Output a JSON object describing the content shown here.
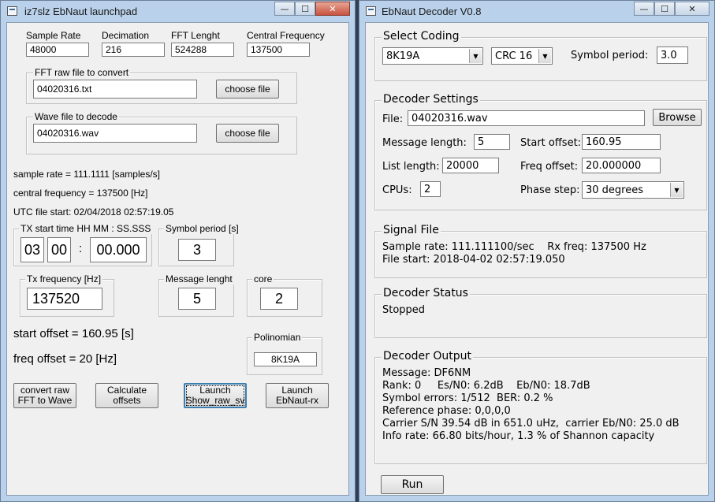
{
  "launchpad": {
    "title": "iz7slz EbNaut launchpad",
    "fields": {
      "sample_rate": {
        "label": "Sample Rate",
        "value": "48000"
      },
      "decimation": {
        "label": "Decimation",
        "value": "216"
      },
      "fft_length": {
        "label": "FFT Lenght",
        "value": "524288"
      },
      "central_freq": {
        "label": "Central Frequency",
        "value": "137500"
      }
    },
    "fft_group": {
      "legend": "FFT raw file to convert",
      "value": "04020316.txt",
      "button": "choose file"
    },
    "wave_group": {
      "legend": "Wave file to decode",
      "value": "04020316.wav",
      "button": "choose file"
    },
    "info": {
      "sample_rate": "sample rate = 111.1111 [samples/s]",
      "central_frequency": "central frequency = 137500 [Hz]",
      "utc_start": "UTC file start: 02/04/2018 02:57:19.05"
    },
    "tx_start": {
      "legend": "TX start time  HH MM : SS.SSS",
      "hh": "03",
      "mm": "00",
      "colon": ":",
      "ss": "00.000"
    },
    "symbol_period": {
      "legend": "Symbol period [s]",
      "value": "3"
    },
    "tx_freq": {
      "legend": "Tx frequency [Hz]",
      "value": "137520"
    },
    "message_length": {
      "legend": "Message lenght",
      "value": "5"
    },
    "core": {
      "legend": "core",
      "value": "2"
    },
    "start_offset": "start offset =  160.95 [s]",
    "freq_offset": "freq offset =  20 [Hz]",
    "polinomian": {
      "legend": "Polinomian",
      "value": "8K19A"
    },
    "buttons": {
      "convert": "convert raw\nFFT to Wave",
      "calculate": "Calculate\noffsets",
      "show_raw": "Launch\nShow_raw_sv",
      "ebnaut": "Launch\nEbNaut-rx"
    }
  },
  "decoder": {
    "title": "EbNaut Decoder V0.8",
    "select_coding": {
      "legend": "Select Coding",
      "coding": "8K19A",
      "crc": "CRC 16",
      "symbol_label": "Symbol period:",
      "symbol_value": "3.0"
    },
    "settings": {
      "legend": "Decoder Settings",
      "file_label": "File:",
      "file_value": "04020316.wav",
      "browse": "Browse",
      "msg_len_label": "Message length:",
      "msg_len_value": "5",
      "start_offset_label": "Start offset:",
      "start_offset_value": "160.95",
      "list_len_label": "List length:",
      "list_len_value": "20000",
      "freq_offset_label": "Freq offset:",
      "freq_offset_value": "20.000000",
      "cpus_label": "CPUs:",
      "cpus_value": "2",
      "phase_label": "Phase step:",
      "phase_value": "30 degrees"
    },
    "signal_file": {
      "legend": "Signal File",
      "line1": "Sample rate: 111.111100/sec    Rx freq: 137500 Hz",
      "line2": "File start: 2018-04-02 02:57:19.050"
    },
    "status": {
      "legend": "Decoder Status",
      "value": "Stopped"
    },
    "output": {
      "legend": "Decoder Output",
      "lines": [
        "Message: DF6NM",
        "Rank: 0     Es/N0: 6.2dB    Eb/N0: 18.7dB",
        "Symbol errors: 1/512  BER: 0.2 %",
        "Reference phase: 0,0,0,0",
        "Carrier S/N 39.54 dB in 651.0 uHz,  carrier Eb/N0: 25.0 dB",
        "Info rate: 66.80 bits/hour, 1.3 % of Shannon capacity"
      ]
    },
    "run": "Run"
  },
  "window_buttons": {
    "min": "—",
    "max": "☐",
    "close": "✕"
  }
}
